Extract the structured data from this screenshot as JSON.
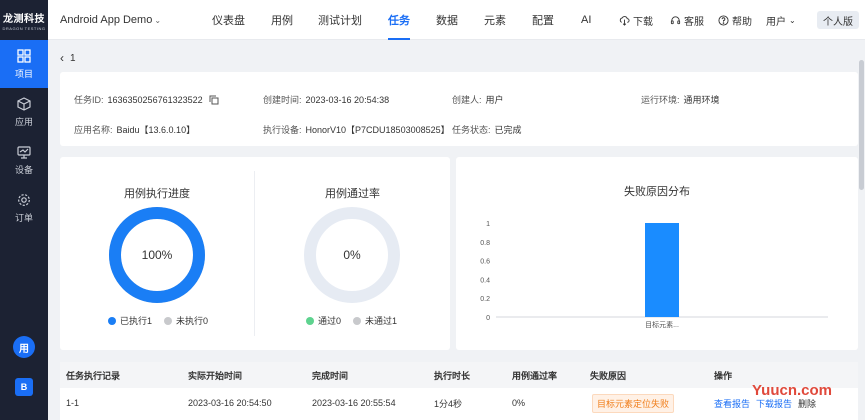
{
  "sidebar": {
    "logo_cn": "龙测科技",
    "logo_en": "DRAGON TESTING",
    "items": [
      {
        "label": "项目",
        "icon": "grid-icon"
      },
      {
        "label": "应用",
        "icon": "cube-icon"
      },
      {
        "label": "设备",
        "icon": "monitor-icon"
      },
      {
        "label": "订单",
        "icon": "gear-icon"
      }
    ],
    "bottom_bubble": "用",
    "bottom_doc": "B"
  },
  "topbar": {
    "app_name": "Android App Demo",
    "tabs": [
      "仪表盘",
      "用例",
      "测试计划",
      "任务",
      "数据",
      "元素",
      "配置",
      "AI"
    ],
    "active_tab": "任务",
    "download": "下载",
    "support": "客服",
    "help": "帮助",
    "user": "用户",
    "personal": "个人版"
  },
  "breadcrumb": {
    "back": "1"
  },
  "task_info": {
    "task_id_label": "任务ID:",
    "task_id": "1636350256761323522",
    "created_time_label": "创建时间:",
    "created_time": "2023-03-16 20:54:38",
    "creator_label": "创建人:",
    "creator": "用户",
    "env_label": "运行环境:",
    "env": "通用环境",
    "app_label": "应用名称:",
    "app": "Baidu【13.6.0.10】",
    "device_label": "执行设备:",
    "device": "HonorV10【P7CDU18503008525】",
    "status_label": "任务状态:",
    "status": "已完成"
  },
  "progress": {
    "title": "用例执行进度",
    "percent_text": "100%",
    "fraction": 1.0,
    "legend_done": "已执行1",
    "legend_todo": "未执行0",
    "color_done": "#1a7ef5",
    "color_todo": "#c8c9cc"
  },
  "pass_rate": {
    "title": "用例通过率",
    "percent_text": "0%",
    "fraction": 0.0,
    "legend_pass": "通过0",
    "legend_fail": "未通过1",
    "color_pass": "#5ed38f",
    "color_fail": "#c8c9cc",
    "ring_color": "#e6ebf3"
  },
  "chart_data": {
    "type": "bar",
    "title": "失败原因分布",
    "categories": [
      "目标元素..."
    ],
    "values": [
      1
    ],
    "ylim": [
      0,
      1
    ],
    "yticks": [
      "0",
      "0.2",
      "0.4",
      "0.6",
      "0.8",
      "1"
    ],
    "color": "#1a8cff",
    "xlabel": "",
    "ylabel": ""
  },
  "table": {
    "headers": [
      "任务执行记录",
      "实际开始时间",
      "完成时间",
      "执行时长",
      "用例通过率",
      "失败原因",
      "操作"
    ],
    "rows": [
      {
        "record": "1-1",
        "start": "2023-03-16 20:54:50",
        "end": "2023-03-16 20:55:54",
        "duration": "1分4秒",
        "pass_rate": "0%",
        "fail_reason": "目标元素定位失败",
        "op_view": "查看报告",
        "op_download": "下载报告",
        "op_delete": "删除"
      }
    ]
  },
  "watermark": "Yuucn.com"
}
